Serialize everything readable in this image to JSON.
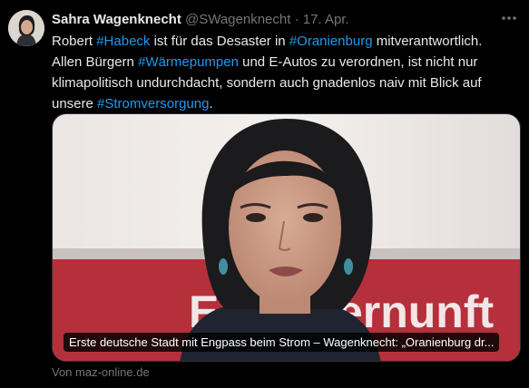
{
  "tweet": {
    "author_name": "Sahra Wagenknecht",
    "handle": "@SWagenknecht",
    "separator": "·",
    "date": "17. Apr.",
    "more_icon": "more-horizontal-icon",
    "text_parts": {
      "t1": "Robert ",
      "h1": "#Habeck",
      "t2": " ist für das Desaster in ",
      "h2": "#Oranienburg",
      "t3": " mitverantwortlich. Allen Bürgern ",
      "h3": "#Wärmepumpen",
      "t4": " und E-Autos zu verordnen, ist nicht nur klimapolitisch undurchdacht, sondern auch gnadenlos naiv mit Blick auf unsere ",
      "h4": "#Stromversorgung",
      "t5": "."
    },
    "link_card": {
      "image_text": "Eigenvernunft",
      "caption": "Erste deutsche Stadt mit Engpass beim Strom – Wagenknecht: „Oranienburg dr...",
      "source": "Von maz-online.de"
    }
  },
  "colors": {
    "background": "#000000",
    "text": "#e7e9ea",
    "muted": "#71767b",
    "hashtag": "#1d9bf0",
    "banner_red": "#b5303b"
  }
}
